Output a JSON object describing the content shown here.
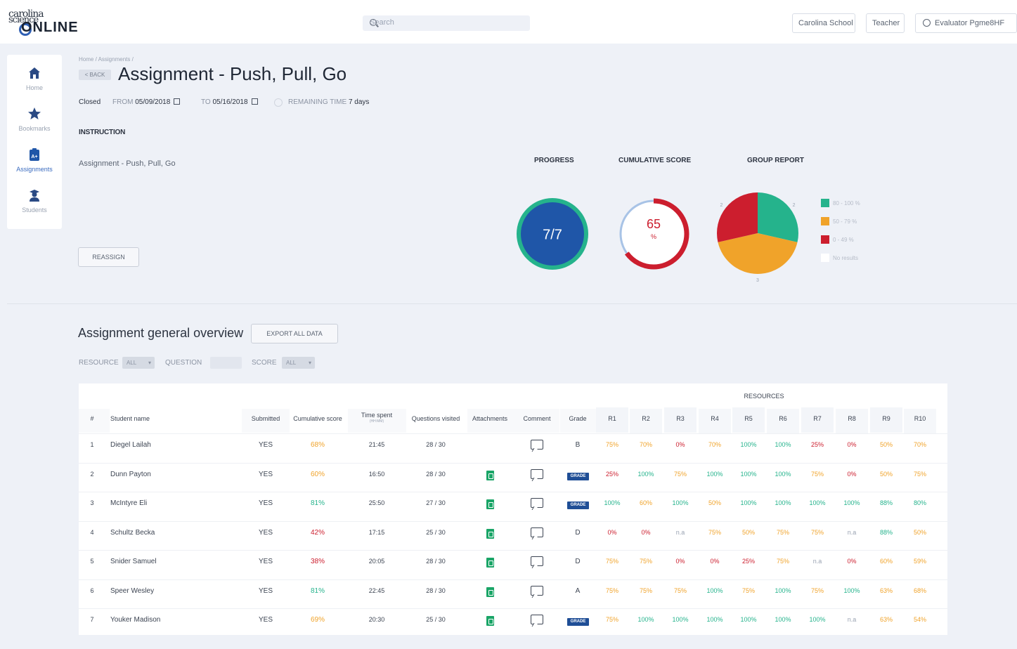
{
  "header": {
    "logo_line1": "carolina",
    "logo_line2": "science",
    "logo_line3": "ONLINE",
    "search_placeholder": "Search",
    "school_label": "Carolina School",
    "role_label": "Teacher",
    "user_label": "Evaluator Pgme8HF"
  },
  "sidebar": {
    "items": [
      {
        "label": "Home",
        "icon": "home-icon"
      },
      {
        "label": "Bookmarks",
        "icon": "star-icon"
      },
      {
        "label": "Assignments",
        "icon": "clipboard-icon"
      },
      {
        "label": "Students",
        "icon": "student-icon"
      }
    ]
  },
  "assignment": {
    "breadcrumb": "Home / Assignments /",
    "back_label": "< BACK",
    "title": "Assignment - Push, Pull, Go",
    "status": "Closed",
    "from_label": "FROM",
    "from_date": "05/09/2018",
    "to_label": "TO",
    "to_date": "05/16/2018",
    "remaining_label": "REMAINING TIME",
    "remaining_value": "7 days",
    "instruction_heading": "INSTRUCTION",
    "instruction_text": "Assignment - Push, Pull, Go",
    "reassign_label": "REASSIGN"
  },
  "charts": {
    "progress_label": "PROGRESS",
    "progress_value": "7/7",
    "score_label": "CUMULATIVE SCORE",
    "score_value": "65",
    "score_unit": "%",
    "group_label": "GROUP REPORT",
    "legend": [
      {
        "label": "80 - 100 %",
        "color": "#25b38c"
      },
      {
        "label": "50 - 79 %",
        "color": "#f0a32a"
      },
      {
        "label": "0 - 49 %",
        "color": "#cc1e2e"
      },
      {
        "label": "No results",
        "color": "#ffffff"
      }
    ],
    "colors": {
      "progress_fill": "#1f56a8",
      "progress_ring": "#25b38c",
      "score_ring": "#cc1e2e",
      "score_track": "#a8c3e6"
    }
  },
  "chart_data": {
    "type": "pie",
    "title": "GROUP REPORT",
    "categories": [
      "80 - 100 %",
      "50 - 79 %",
      "0 - 49 %",
      "No results"
    ],
    "values": [
      2,
      3,
      2,
      0
    ],
    "slice_labels": [
      "2",
      "3",
      "2",
      ""
    ]
  },
  "overview": {
    "title": "Assignment general overview",
    "export_label": "EXPORT ALL DATA",
    "filter_resource_label": "RESOURCE",
    "filter_resource_value": "ALL",
    "filter_question_label": "QUESTION",
    "filter_score_label": "SCORE",
    "filter_score_value": "ALL"
  },
  "table": {
    "resources_group_label": "RESOURCES",
    "columns": [
      "#",
      "Student name",
      "Submitted",
      "Cumulative score",
      "Time spent",
      "Questions visited",
      "Attachments",
      "Comment",
      "Grade",
      "R1",
      "R2",
      "R3",
      "R4",
      "R5",
      "R6",
      "R7",
      "R8",
      "R9",
      "R10"
    ],
    "time_subheader": "(HH:MM)",
    "rows": [
      {
        "num": "1",
        "name": "Diegel Lailah",
        "submitted": "YES",
        "score": "68%",
        "time": "21:45",
        "questions": "28 / 30",
        "attach": false,
        "grade": "B",
        "grade_badge": false,
        "res": [
          "75%",
          "70%",
          "0%",
          "70%",
          "100%",
          "100%",
          "25%",
          "0%",
          "50%",
          "70%"
        ]
      },
      {
        "num": "2",
        "name": "Dunn Payton",
        "submitted": "YES",
        "score": "60%",
        "time": "16:50",
        "questions": "28 / 30",
        "attach": true,
        "grade": "GRADE",
        "grade_badge": true,
        "res": [
          "25%",
          "100%",
          "75%",
          "100%",
          "100%",
          "100%",
          "75%",
          "0%",
          "50%",
          "75%"
        ]
      },
      {
        "num": "3",
        "name": "McIntyre Eli",
        "submitted": "YES",
        "score": "81%",
        "time": "25:50",
        "questions": "27 / 30",
        "attach": true,
        "grade": "GRADE",
        "grade_badge": true,
        "res": [
          "100%",
          "60%",
          "100%",
          "50%",
          "100%",
          "100%",
          "100%",
          "100%",
          "88%",
          "80%"
        ]
      },
      {
        "num": "4",
        "name": "Schultz Becka",
        "submitted": "YES",
        "score": "42%",
        "time": "17:15",
        "questions": "25 / 30",
        "attach": true,
        "grade": "D",
        "grade_badge": false,
        "res": [
          "0%",
          "0%",
          "n.a",
          "75%",
          "50%",
          "75%",
          "75%",
          "n.a",
          "88%",
          "50%"
        ]
      },
      {
        "num": "5",
        "name": "Snider Samuel",
        "submitted": "YES",
        "score": "38%",
        "time": "20:05",
        "questions": "28 / 30",
        "attach": true,
        "grade": "D",
        "grade_badge": false,
        "res": [
          "75%",
          "75%",
          "0%",
          "0%",
          "25%",
          "75%",
          "n.a",
          "0%",
          "60%",
          "59%"
        ]
      },
      {
        "num": "6",
        "name": "Speer Wesley",
        "submitted": "YES",
        "score": "81%",
        "time": "22:45",
        "questions": "28 / 30",
        "attach": true,
        "grade": "A",
        "grade_badge": false,
        "res": [
          "75%",
          "75%",
          "75%",
          "100%",
          "75%",
          "100%",
          "75%",
          "100%",
          "63%",
          "68%"
        ]
      },
      {
        "num": "7",
        "name": "Youker Madison",
        "submitted": "YES",
        "score": "69%",
        "time": "20:30",
        "questions": "25 / 30",
        "attach": true,
        "grade": "GRADE",
        "grade_badge": true,
        "res": [
          "75%",
          "100%",
          "100%",
          "100%",
          "100%",
          "100%",
          "100%",
          "n.a",
          "63%",
          "54%"
        ]
      }
    ]
  }
}
